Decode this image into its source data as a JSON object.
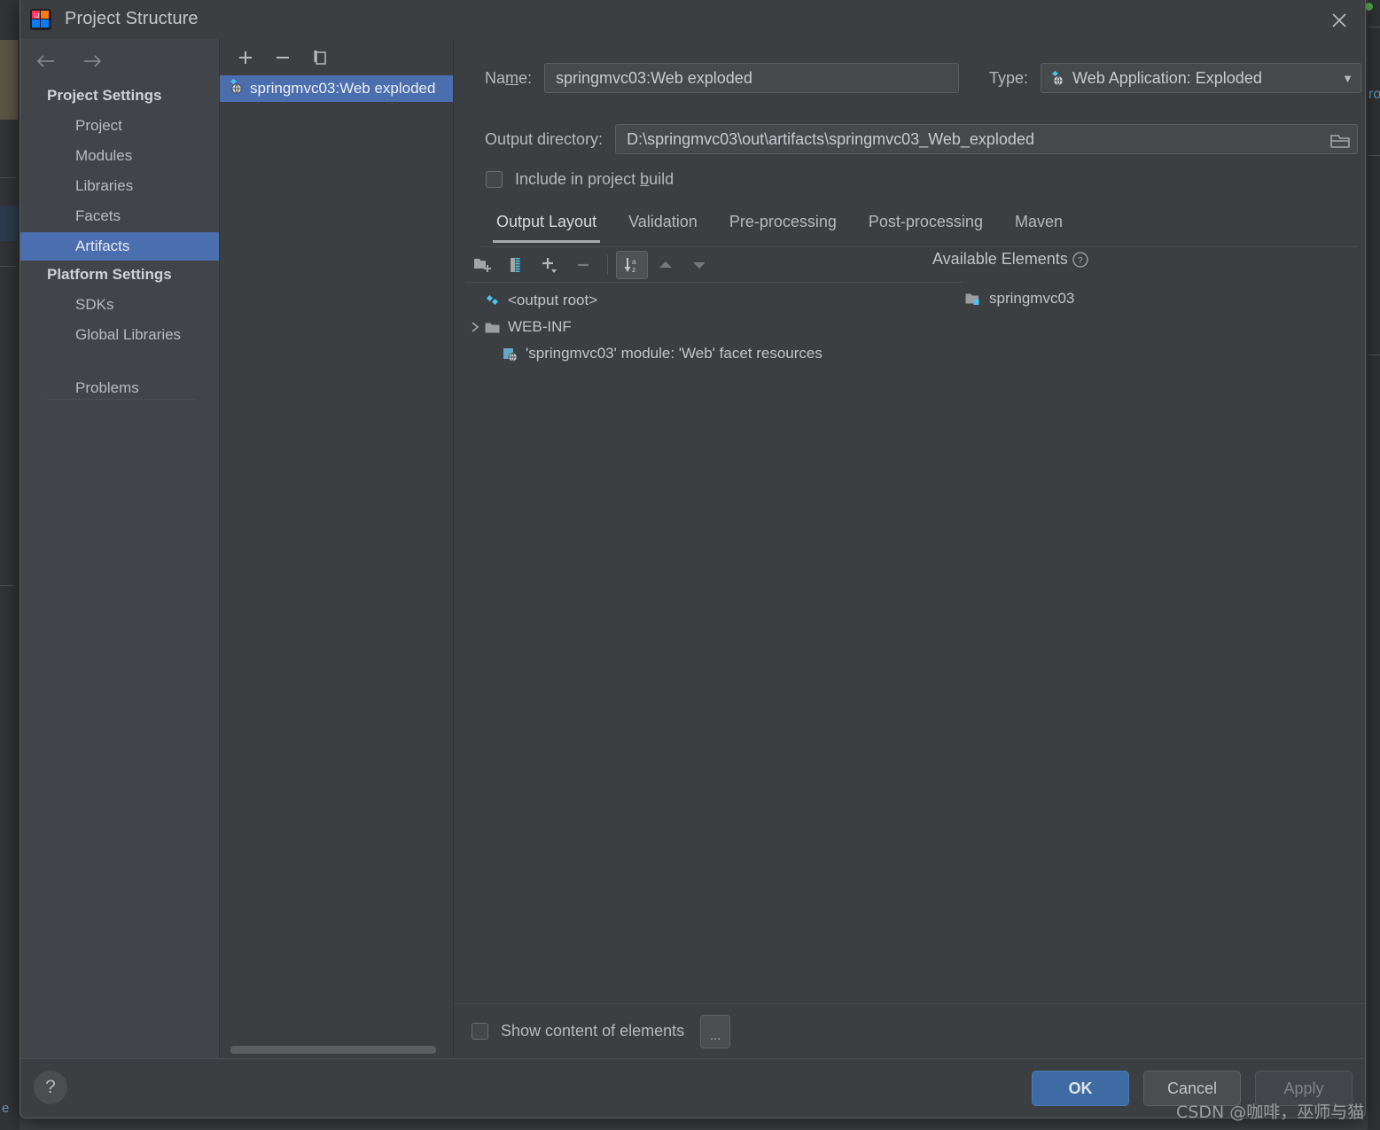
{
  "window": {
    "title": "Project Structure",
    "app_icon": "intellij-idea-icon",
    "close_icon": "close-icon"
  },
  "sidebar": {
    "back_icon": "arrow-left-icon",
    "forward_icon": "arrow-right-icon",
    "groups": [
      {
        "header": "Project Settings"
      },
      {
        "header": "Platform Settings"
      }
    ],
    "items": [
      {
        "label": "Project",
        "selected": false
      },
      {
        "label": "Modules",
        "selected": false
      },
      {
        "label": "Libraries",
        "selected": false
      },
      {
        "label": "Facets",
        "selected": false
      },
      {
        "label": "Artifacts",
        "selected": true
      },
      {
        "label": "SDKs",
        "selected": false
      },
      {
        "label": "Global Libraries",
        "selected": false
      },
      {
        "label": "Problems",
        "selected": false
      }
    ]
  },
  "artifacts_panel": {
    "toolbar": [
      {
        "icon": "plus-icon",
        "name": "add-artifact-button"
      },
      {
        "icon": "minus-icon",
        "name": "remove-artifact-button"
      },
      {
        "icon": "copy-icon",
        "name": "copy-artifact-button"
      }
    ],
    "items": [
      {
        "label": "springmvc03:Web exploded",
        "icon": "web-exploded-artifact-icon",
        "selected": true
      }
    ]
  },
  "detail": {
    "name_label": "Name:",
    "name_value": "springmvc03:Web exploded",
    "type_label": "Type:",
    "type_value": "Web Application: Exploded",
    "type_icon": "web-exploded-artifact-icon",
    "output_dir_label": "Output directory:",
    "output_dir_value": "D:\\springmvc03\\out\\artifacts\\springmvc03_Web_exploded",
    "browse_icon": "folder-open-icon",
    "include_in_build_label": "Include in project build",
    "include_in_build_checked": false,
    "tabs": [
      {
        "label": "Output Layout",
        "active": true
      },
      {
        "label": "Validation",
        "active": false
      },
      {
        "label": "Pre-processing",
        "active": false
      },
      {
        "label": "Post-processing",
        "active": false
      },
      {
        "label": "Maven",
        "active": false
      }
    ],
    "layout_toolbar": [
      {
        "icon": "create-directory-icon",
        "name": "create-directory-button",
        "active": false
      },
      {
        "icon": "create-archive-icon",
        "name": "create-archive-button",
        "active": false
      },
      {
        "icon": "add-copy-icon",
        "name": "add-copy-of-button",
        "active": false
      },
      {
        "icon": "minus-icon",
        "name": "remove-element-button",
        "active": false
      },
      {
        "icon": "sort-alpha-icon",
        "name": "sort-alphabetically-button",
        "active": true
      },
      {
        "icon": "arrow-up-icon",
        "name": "move-up-button",
        "active": false
      },
      {
        "icon": "arrow-down-icon",
        "name": "move-down-button",
        "active": false
      }
    ],
    "tree": [
      {
        "label": "<output root>",
        "icon": "output-root-icon",
        "indent": 0,
        "expandable": false,
        "expanded": false
      },
      {
        "label": "WEB-INF",
        "icon": "folder-icon",
        "indent": 0,
        "expandable": true,
        "expanded": false
      },
      {
        "label": "'springmvc03' module: 'Web' facet resources",
        "icon": "web-facet-icon",
        "indent": 1,
        "expandable": false,
        "expanded": false
      }
    ],
    "available_elements_label": "Available Elements",
    "available_help_icon": "help-circle-icon",
    "available_items": [
      {
        "label": "springmvc03",
        "icon": "module-icon"
      }
    ],
    "show_content_label": "Show content of elements",
    "show_content_checked": false,
    "dots_button_label": "..."
  },
  "footer": {
    "help_label": "?",
    "ok_label": "OK",
    "cancel_label": "Cancel",
    "apply_label": "Apply"
  },
  "watermark": "CSDN @咖啡，巫师与猫",
  "colors": {
    "accent_blue": "#4b6eaf",
    "ok_button": "#3f6ba4",
    "dialog_bg": "#3c3f41",
    "sidebar_bg": "#41454a",
    "text": "#b8bbbe"
  },
  "backdrop": {
    "edge_text_left": "e",
    "edge_text_right": "ro"
  }
}
